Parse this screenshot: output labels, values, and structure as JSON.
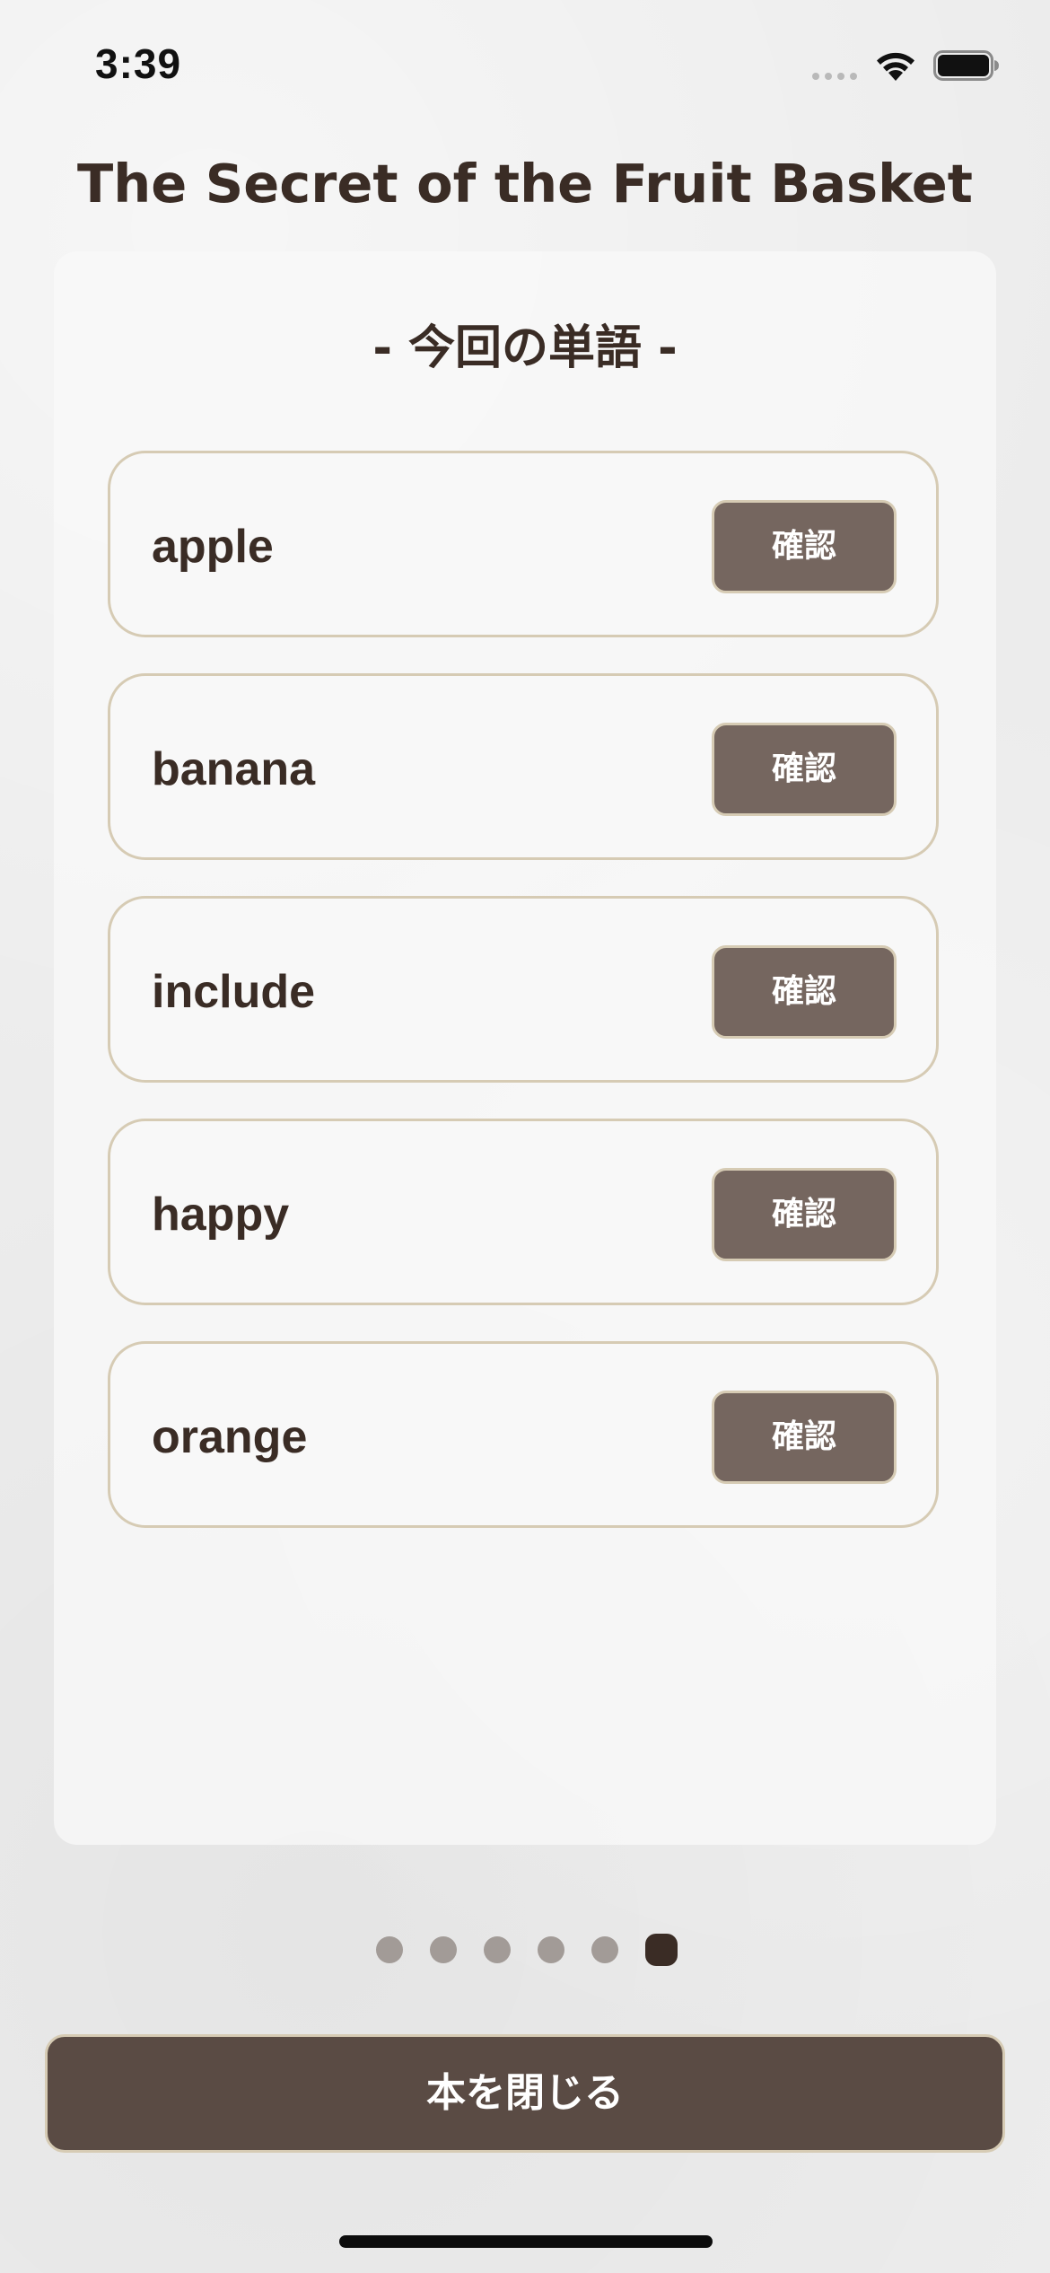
{
  "status_bar": {
    "time": "3:39",
    "icons": [
      "cellular-signal-icon",
      "wifi-icon",
      "battery-icon"
    ]
  },
  "book": {
    "title": "The Secret of the Fruit Basket"
  },
  "word_card": {
    "heading": "- 今回の単語 -",
    "words": [
      {
        "word": "apple",
        "button_label": "確認"
      },
      {
        "word": "banana",
        "button_label": "確認"
      },
      {
        "word": "include",
        "button_label": "確認"
      },
      {
        "word": "happy",
        "button_label": "確認"
      },
      {
        "word": "orange",
        "button_label": "確認"
      }
    ]
  },
  "pagination": {
    "total_pages": 6,
    "current_page": 6
  },
  "footer": {
    "close_button_label": "本を閉じる"
  },
  "colors": {
    "text_dark": "#3a2c25",
    "button": "#75665f",
    "close_button": "#5a4b44",
    "border": "#d6cbb4",
    "dot_inactive": "#a29b97"
  }
}
